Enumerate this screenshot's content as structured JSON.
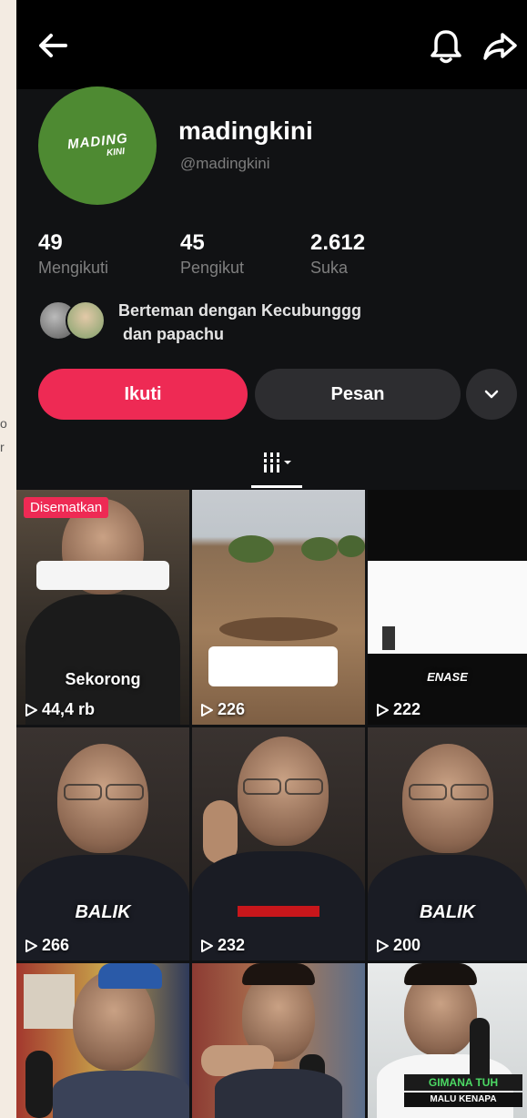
{
  "edge_text": [
    "o",
    "r"
  ],
  "topbar": {
    "back_icon": "arrow-left-icon",
    "bell_icon": "bell-icon",
    "share_icon": "share-arrow-icon"
  },
  "profile": {
    "avatar_logo_line1": "MADING",
    "avatar_logo_line2": "KINI",
    "username": "madingkini",
    "handle": "@madingkini",
    "stats": [
      {
        "value": "49",
        "label": "Mengikuti"
      },
      {
        "value": "45",
        "label": "Pengikut"
      },
      {
        "value": "2.612",
        "label": "Suka"
      }
    ],
    "friends_line1": "Berteman dengan Kecubunggg",
    "friends_line2": "dan papachu"
  },
  "actions": {
    "follow": "Ikuti",
    "message": "Pesan",
    "more_icon": "chevron-down-icon"
  },
  "tab": {
    "icon": "grid-bars-icon"
  },
  "videos": [
    {
      "views": "44,4 rb",
      "pinned": "Disematkan",
      "caption": "Sekorong"
    },
    {
      "views": "226",
      "caption": ""
    },
    {
      "views": "222",
      "caption": "ENASE"
    },
    {
      "views": "266",
      "caption": "BALIK"
    },
    {
      "views": "232",
      "caption": ""
    },
    {
      "views": "200",
      "caption": "BALIK"
    },
    {
      "views": "",
      "caption": ""
    },
    {
      "views": "",
      "caption": ""
    },
    {
      "views": "",
      "caption": "GIMANA TUH",
      "caption2": "MALU KENAPA"
    }
  ],
  "colors": {
    "accent": "#ee2a54",
    "background": "#111214",
    "avatar_bg": "#4e8a32"
  }
}
